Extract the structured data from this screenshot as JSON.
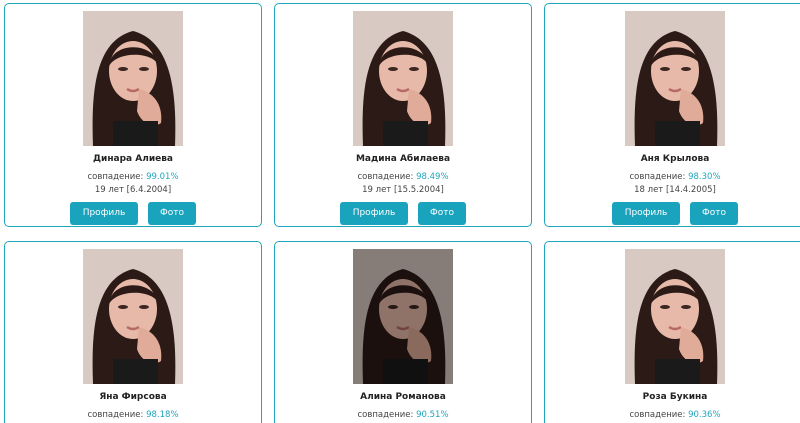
{
  "labels": {
    "match_prefix": "совпадение: ",
    "profile_button": "Профиль",
    "photo_button": "Фото"
  },
  "colors": {
    "accent": "#1fa6bd",
    "button": "#1aa3bd"
  },
  "cards": [
    {
      "name": "Динара Алиева",
      "match": "99.01%",
      "age": "19 лет [6.4.2004]",
      "dim": false
    },
    {
      "name": "Мадина Абилаева",
      "match": "98.49%",
      "age": "19 лет [15.5.2004]",
      "dim": false
    },
    {
      "name": "Аня Крылова",
      "match": "98.30%",
      "age": "18 лет [14.4.2005]",
      "dim": false
    },
    {
      "name": "Яна Фирсова",
      "match": "98.18%",
      "dim": false
    },
    {
      "name": "Алина Романова",
      "match": "90.51%",
      "dim": true
    },
    {
      "name": "Роза Букина",
      "match": "90.36%",
      "dim": false
    }
  ]
}
